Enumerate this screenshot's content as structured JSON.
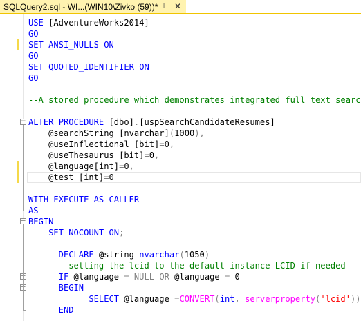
{
  "tab": {
    "title": "SQLQuery2.sql - WI...(WIN10\\Zivko (59))*",
    "pin_icon": "⊤",
    "close_icon": "✕"
  },
  "colors": {
    "keyword": "#0000ff",
    "comment": "#008000",
    "string": "#ff0000",
    "operator": "#808080",
    "function": "#ff00ff",
    "text": "#000000",
    "change_bar": "#f5d94a",
    "tab_background": "#fff3b0",
    "tab_accent": "#f0c400"
  },
  "editor": {
    "lines": [
      {
        "tokens": [
          {
            "t": "USE ",
            "c": "keyword"
          },
          {
            "t": "[AdventureWorks2014]",
            "c": "text"
          }
        ]
      },
      {
        "tokens": [
          {
            "t": "GO",
            "c": "keyword"
          }
        ]
      },
      {
        "change": true,
        "tokens": [
          {
            "t": "SET ",
            "c": "keyword"
          },
          {
            "t": "ANSI_NULLS ",
            "c": "keyword"
          },
          {
            "t": "ON",
            "c": "keyword"
          }
        ]
      },
      {
        "tokens": [
          {
            "t": "GO",
            "c": "keyword"
          }
        ]
      },
      {
        "tokens": [
          {
            "t": "SET ",
            "c": "keyword"
          },
          {
            "t": "QUOTED_IDENTIFIER ",
            "c": "keyword"
          },
          {
            "t": "ON",
            "c": "keyword"
          }
        ]
      },
      {
        "tokens": [
          {
            "t": "GO",
            "c": "keyword"
          }
        ]
      },
      {
        "tokens": []
      },
      {
        "tokens": [
          {
            "t": "--A stored procedure which demonstrates integrated full text search",
            "c": "comment"
          }
        ]
      },
      {
        "tokens": []
      },
      {
        "fold": "open",
        "tokens": [
          {
            "t": "ALTER ",
            "c": "keyword"
          },
          {
            "t": "PROCEDURE ",
            "c": "keyword"
          },
          {
            "t": "[dbo]",
            "c": "text"
          },
          {
            "t": ".",
            "c": "operator"
          },
          {
            "t": "[uspSearchCandidateResumes]",
            "c": "text"
          }
        ]
      },
      {
        "tokens": [
          {
            "t": "    @searchString ",
            "c": "text"
          },
          {
            "t": "[nvarchar]",
            "c": "text"
          },
          {
            "t": "(",
            "c": "operator"
          },
          {
            "t": "1000",
            "c": "text"
          },
          {
            "t": "),",
            "c": "operator"
          }
        ]
      },
      {
        "tokens": [
          {
            "t": "    @useInflectional ",
            "c": "text"
          },
          {
            "t": "[bit]",
            "c": "text"
          },
          {
            "t": "=",
            "c": "operator"
          },
          {
            "t": "0",
            "c": "text"
          },
          {
            "t": ",",
            "c": "operator"
          }
        ]
      },
      {
        "tokens": [
          {
            "t": "    @useThesaurus ",
            "c": "text"
          },
          {
            "t": "[bit]",
            "c": "text"
          },
          {
            "t": "=",
            "c": "operator"
          },
          {
            "t": "0",
            "c": "text"
          },
          {
            "t": ",",
            "c": "operator"
          }
        ]
      },
      {
        "change": true,
        "tokens": [
          {
            "t": "    @language",
            "c": "text"
          },
          {
            "t": "[int]",
            "c": "text"
          },
          {
            "t": "=",
            "c": "operator"
          },
          {
            "t": "0",
            "c": "text"
          },
          {
            "t": ",",
            "c": "operator"
          }
        ]
      },
      {
        "change": true,
        "current": true,
        "tokens": [
          {
            "t": "    @test ",
            "c": "text"
          },
          {
            "t": "[int]",
            "c": "text"
          },
          {
            "t": "=",
            "c": "operator"
          },
          {
            "t": "0",
            "c": "text"
          }
        ]
      },
      {
        "tokens": []
      },
      {
        "tokens": [
          {
            "t": "WITH ",
            "c": "keyword"
          },
          {
            "t": "EXECUTE ",
            "c": "keyword"
          },
          {
            "t": "AS ",
            "c": "keyword"
          },
          {
            "t": "CALLER",
            "c": "keyword"
          }
        ]
      },
      {
        "tokens": [
          {
            "t": "AS",
            "c": "keyword"
          }
        ]
      },
      {
        "fold": "open",
        "tokens": [
          {
            "t": "BEGIN",
            "c": "keyword"
          }
        ]
      },
      {
        "tokens": [
          {
            "t": "    SET ",
            "c": "keyword"
          },
          {
            "t": "NOCOUNT ",
            "c": "keyword"
          },
          {
            "t": "ON",
            "c": "keyword"
          },
          {
            "t": ";",
            "c": "operator"
          }
        ]
      },
      {
        "tokens": []
      },
      {
        "tokens": [
          {
            "t": "      DECLARE ",
            "c": "keyword"
          },
          {
            "t": "@string ",
            "c": "text"
          },
          {
            "t": "nvarchar",
            "c": "keyword"
          },
          {
            "t": "(",
            "c": "operator"
          },
          {
            "t": "1050",
            "c": "text"
          },
          {
            "t": ")",
            "c": "operator"
          }
        ]
      },
      {
        "tokens": [
          {
            "t": "      --setting the lcid to the default instance LCID if needed",
            "c": "comment"
          }
        ]
      },
      {
        "fold": "open",
        "tokens": [
          {
            "t": "      IF ",
            "c": "keyword"
          },
          {
            "t": "@language ",
            "c": "text"
          },
          {
            "t": "= ",
            "c": "operator"
          },
          {
            "t": "NULL ",
            "c": "operator"
          },
          {
            "t": "OR ",
            "c": "operator"
          },
          {
            "t": "@language ",
            "c": "text"
          },
          {
            "t": "= ",
            "c": "operator"
          },
          {
            "t": "0",
            "c": "text"
          }
        ]
      },
      {
        "fold": "open",
        "tokens": [
          {
            "t": "      BEGIN",
            "c": "keyword"
          }
        ]
      },
      {
        "tokens": [
          {
            "t": "            SELECT ",
            "c": "keyword"
          },
          {
            "t": "@language ",
            "c": "text"
          },
          {
            "t": "=",
            "c": "operator"
          },
          {
            "t": "CONVERT",
            "c": "function"
          },
          {
            "t": "(",
            "c": "operator"
          },
          {
            "t": "int",
            "c": "keyword"
          },
          {
            "t": ", ",
            "c": "operator"
          },
          {
            "t": "serverproperty",
            "c": "function"
          },
          {
            "t": "(",
            "c": "operator"
          },
          {
            "t": "'lcid'",
            "c": "string"
          },
          {
            "t": "))",
            "c": "operator"
          }
        ]
      },
      {
        "tokens": [
          {
            "t": "      END",
            "c": "keyword"
          }
        ]
      }
    ]
  }
}
